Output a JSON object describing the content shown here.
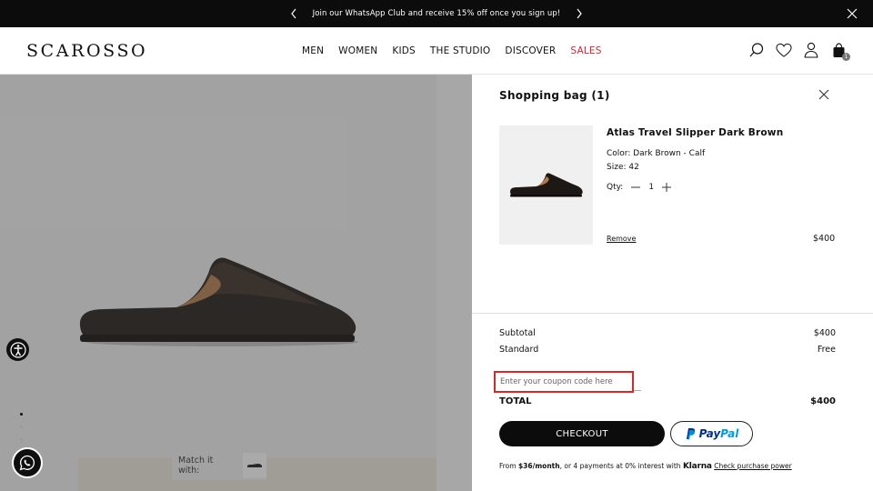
{
  "promo": {
    "text": "Join our WhatsApp Club and receive 15% off once you sign up!"
  },
  "header": {
    "logo": "SCAROSSO",
    "nav": [
      {
        "label": "MEN"
      },
      {
        "label": "WOMEN"
      },
      {
        "label": "KIDS"
      },
      {
        "label": "THE STUDIO"
      },
      {
        "label": "DISCOVER"
      },
      {
        "label": "SALES"
      }
    ],
    "bag_count": "1"
  },
  "product": {
    "match_label": "Match it with:"
  },
  "cart": {
    "title": "Shopping bag (1)",
    "item": {
      "name": "Atlas Travel Slipper Dark Brown",
      "color": "Color: Dark Brown - Calf",
      "size": "Size: 42",
      "qty_label": "Qty:",
      "qty_value": "1",
      "remove_label": "Remove",
      "price": "$400"
    },
    "summary": {
      "subtotal_label": "Subtotal",
      "subtotal_value": "$400",
      "shipping_label": "Standard",
      "shipping_value": "Free",
      "total_label": "TOTAL",
      "total_value": "$400"
    },
    "coupon_placeholder": "Enter your coupon code here",
    "checkout_label": "CHECKOUT",
    "paypal_pay": "Pay",
    "paypal_pal": "Pal",
    "klarna": {
      "prefix": "From ",
      "amount": "$36/month",
      "middle": ", or 4 payments at 0% interest with ",
      "brand": "Klarna",
      "link": "Check purchase power"
    }
  },
  "colors": {
    "sales": "#d9232e",
    "coupon_highlight": "#d62828",
    "dark": "#0c0c0c",
    "paypal_dark": "#003087",
    "paypal_light": "#009cde"
  }
}
